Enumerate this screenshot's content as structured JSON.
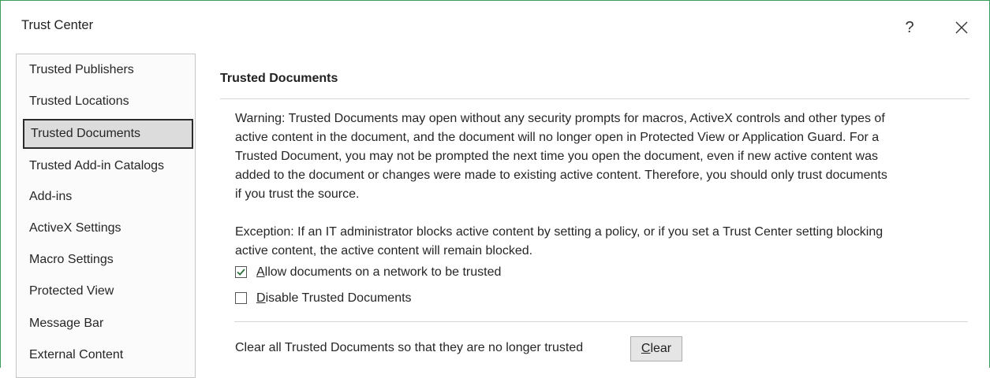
{
  "window": {
    "title": "Trust Center",
    "help_glyph": "?",
    "close_icon": "close-icon"
  },
  "sidebar": {
    "items": [
      {
        "label": "Trusted Publishers",
        "selected": false
      },
      {
        "label": "Trusted Locations",
        "selected": false
      },
      {
        "label": "Trusted Documents",
        "selected": true
      },
      {
        "label": "Trusted Add-in Catalogs",
        "selected": false
      },
      {
        "label": "Add-ins",
        "selected": false
      },
      {
        "label": "ActiveX Settings",
        "selected": false
      },
      {
        "label": "Macro Settings",
        "selected": false
      },
      {
        "label": "Protected View",
        "selected": false
      },
      {
        "label": "Message Bar",
        "selected": false
      },
      {
        "label": "External Content",
        "selected": false
      }
    ]
  },
  "main": {
    "section_title": "Trusted Documents",
    "warning_lines": [
      "Warning: Trusted Documents may open without any security prompts for macros, ActiveX controls and other types of",
      "active content in the document, and the document will no longer open in Protected View or Application Guard. For a",
      "Trusted Document, you may not be prompted the next time you open the document, even if new active content was",
      "added to the document or changes were made to existing active content. Therefore, you should only trust documents",
      "if you trust the source."
    ],
    "exception_lines": [
      "Exception: If an IT administrator blocks active content by setting a policy, or if you set a Trust Center setting blocking",
      "active content, the active content will remain blocked."
    ],
    "checkboxes": {
      "allow_network": {
        "accel": "A",
        "rest": "llow documents on a network to be trusted",
        "checked": true
      },
      "disable_trusted": {
        "accel": "D",
        "rest": "isable Trusted Documents",
        "checked": false
      }
    },
    "clear_text": "Clear all Trusted Documents so that they are no longer trusted",
    "clear_button": {
      "accel": "C",
      "rest": "lear"
    }
  },
  "colors": {
    "window_border": "#3c9e5a",
    "checkmark": "#2b6f3a",
    "selected_bg": "#dcdcdc"
  }
}
